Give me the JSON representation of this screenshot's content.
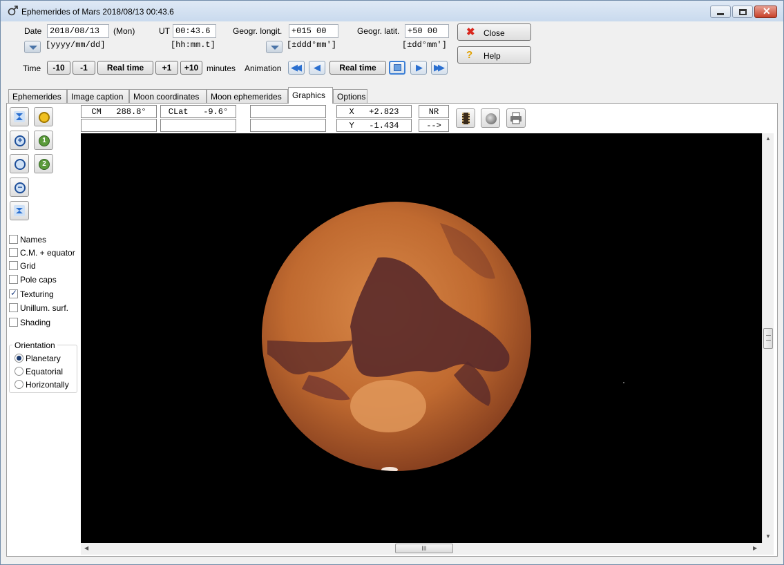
{
  "window": {
    "title": "Ephemerides of Mars  2018/08/13  00:43.6"
  },
  "inputs": {
    "date_label": "Date",
    "date_value": "2018/08/13",
    "weekday": "(Mon)",
    "date_format": "[yyyy/mm/dd]",
    "ut_label": "UT",
    "ut_value": "00:43.6",
    "ut_format": "[hh:mm.t]",
    "longit_label": "Geogr. longit.",
    "longit_value": "+015 00",
    "longit_format": "[±ddd°mm']",
    "latit_label": "Geogr. latit.",
    "latit_value": "+50 00",
    "latit_format": "[±dd°mm']"
  },
  "actions": {
    "close_label": "Close",
    "help_label": "Help"
  },
  "time_controls": {
    "label": "Time",
    "minus10": "-10",
    "minus1": "-1",
    "realtime": "Real time",
    "plus1": "+1",
    "plus10": "+10",
    "unit": "minutes"
  },
  "animation": {
    "label": "Animation",
    "realtime": "Real time"
  },
  "tabs": [
    "Ephemerides",
    "Image caption",
    "Moon coordinates",
    "Moon ephemerides",
    "Graphics",
    "Options"
  ],
  "active_tab": "Graphics",
  "info": {
    "cm": "CM   288.8°",
    "clat": "CLat   -9.6°",
    "x": "X   +2.823",
    "y": "Y   -1.434",
    "nr": "NR",
    "arrow": "-->"
  },
  "options": {
    "checkboxes": [
      {
        "label": "Names",
        "checked": false
      },
      {
        "label": "C.M. + equator",
        "checked": false
      },
      {
        "label": "Grid",
        "checked": false
      },
      {
        "label": "Pole caps",
        "checked": false
      },
      {
        "label": "Texturing",
        "checked": true
      },
      {
        "label": "Unillum. surf.",
        "checked": false
      },
      {
        "label": "Shading",
        "checked": false
      }
    ],
    "orientation": {
      "title": "Orientation",
      "choices": [
        "Planetary",
        "Equatorial",
        "Horizontally"
      ],
      "selected": "Planetary"
    }
  },
  "tool_icons": {
    "zoom_in": "1",
    "zoom_out": "2"
  },
  "scrollbar": {
    "grip": "III"
  },
  "colors": {
    "mars_base": "#c06a30",
    "mars_dark": "#5a2a2a",
    "background": "#000000"
  }
}
